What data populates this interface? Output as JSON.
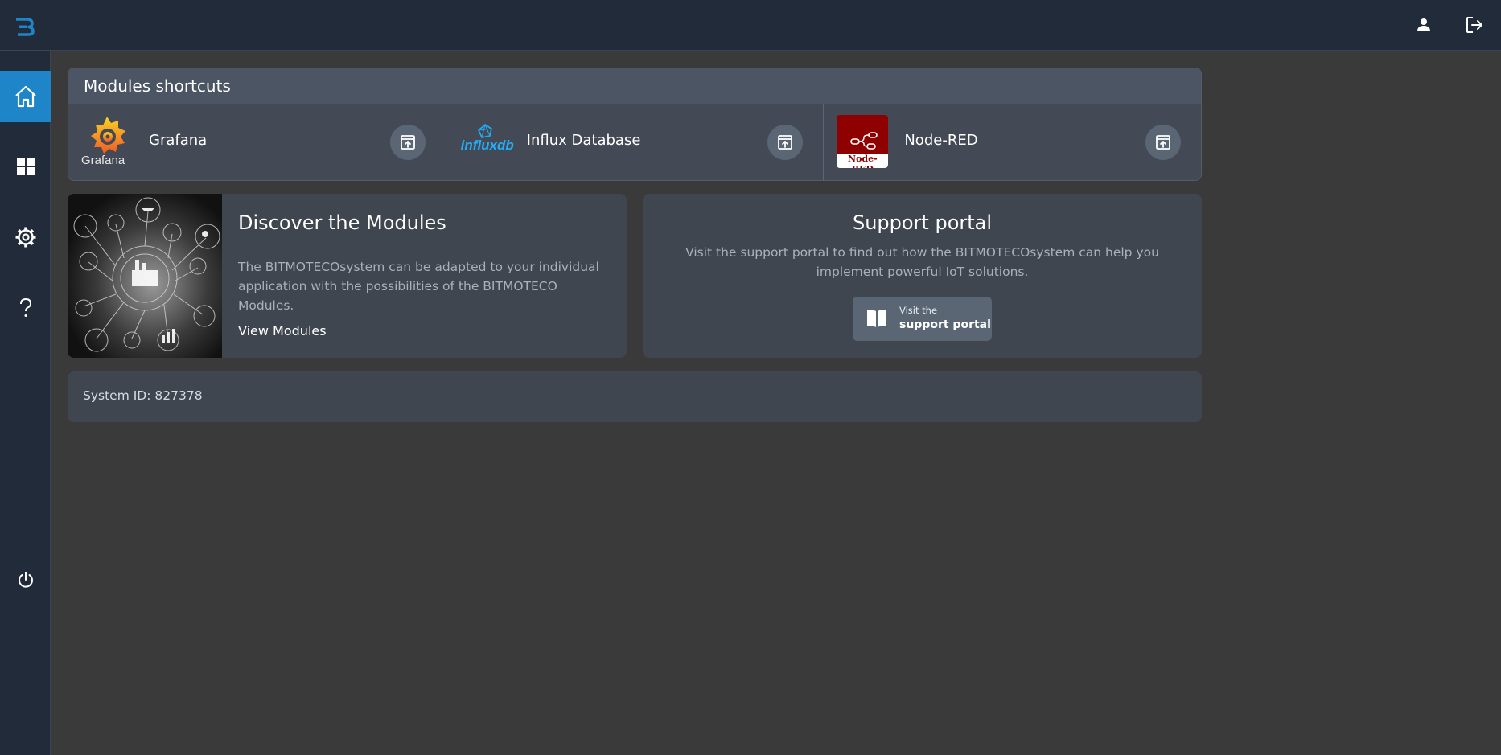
{
  "shortcuts": {
    "title": "Modules shortcuts",
    "items": [
      {
        "label": "Grafana",
        "logo_text": "Grafana"
      },
      {
        "label": "Influx Database",
        "logo_text": "influxdb"
      },
      {
        "label": "Node-RED",
        "logo_text": "Node-RED"
      }
    ]
  },
  "discover": {
    "title": "Discover the Modules",
    "text": "The BITMOTECOsystem can be adapted to your individual application with the possibilities of the BITMOTECO Modules.",
    "link": "View Modules"
  },
  "support": {
    "title": "Support portal",
    "text": "Visit the support portal to find out how the BITMOTECOsystem can help you implement powerful IoT solutions.",
    "button_small": "Visit the",
    "button_big": "support portal"
  },
  "system": {
    "id_text": "System ID: 827378"
  },
  "icons": {
    "sidebar": [
      "home-icon",
      "dashboard-icon",
      "settings-icon",
      "help-icon",
      "power-icon"
    ],
    "topbar": [
      "user-icon",
      "logout-icon"
    ]
  },
  "colors": {
    "accent": "#1e86c8",
    "topbar": "#222b3a",
    "background": "#3a3a3b",
    "card": "#434a55"
  }
}
